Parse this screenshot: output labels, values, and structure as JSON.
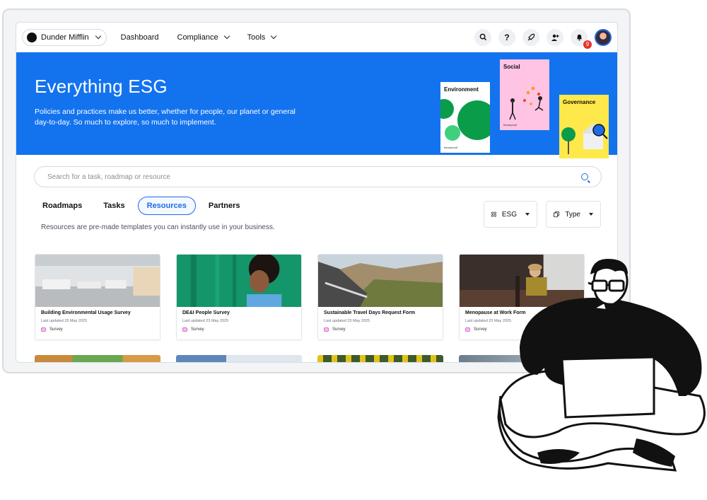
{
  "nav": {
    "org_name": "Dunder Mifflin",
    "links": [
      {
        "label": "Dashboard"
      },
      {
        "label": "Compliance"
      },
      {
        "label": "Tools"
      }
    ],
    "help_glyph": "?",
    "notification_count": "9",
    "icons": [
      "search-icon",
      "help-icon",
      "rocket-icon",
      "add-user-icon",
      "bell-icon"
    ]
  },
  "hero": {
    "title": "Everything ESG",
    "subtitle": "Policies and practices make us better, whether for people, our planet or general day-to-day. So much to explore, so much to implement.",
    "posters": [
      {
        "title": "Environment",
        "footer": "futureproof"
      },
      {
        "title": "Social",
        "footer": "futureproof"
      },
      {
        "title": "Governance",
        "footer": "futureproof"
      }
    ],
    "color": "#1373ef"
  },
  "search": {
    "placeholder": "Search for a task, roadmap or resource"
  },
  "tabs": [
    {
      "label": "Roadmaps",
      "active": false
    },
    {
      "label": "Tasks",
      "active": false
    },
    {
      "label": "Resources",
      "active": true
    },
    {
      "label": "Partners",
      "active": false
    }
  ],
  "filters": [
    {
      "label": "ESG"
    },
    {
      "label": "Type"
    }
  ],
  "description": "Resources are pre-made templates you can instantly use in your business.",
  "cards": [
    {
      "title": "Building Environmental Usage Survey",
      "updated": "Last updated 23 May 2025",
      "type": "Survey"
    },
    {
      "title": "DE&I People Survey",
      "updated": "Last updated 23 May 2025",
      "type": "Survey"
    },
    {
      "title": "Sustainable Travel Days Request Form",
      "updated": "Last updated 23 May 2025",
      "type": "Survey"
    },
    {
      "title": "Menopause at Work Form",
      "updated": "Last updated 23 May 2025",
      "type": "Survey"
    }
  ]
}
